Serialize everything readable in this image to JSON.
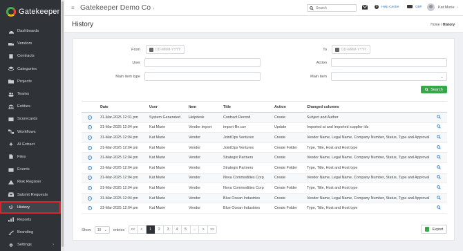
{
  "app": {
    "name": "Gatekeeper",
    "company": "Gatekeeper Demo Co",
    "company_caret": "›"
  },
  "topbar": {
    "search_placeholder": "Search",
    "help": "Help Centre",
    "currency": "GBP",
    "user": "Kat Murie",
    "user_caret": "›"
  },
  "sidebar": {
    "items": [
      {
        "label": "Dashboards",
        "icon": "dashboard-icon"
      },
      {
        "label": "Vendors",
        "icon": "truck-icon"
      },
      {
        "label": "Contracts",
        "icon": "contract-icon"
      },
      {
        "label": "Categories",
        "icon": "layers-icon"
      },
      {
        "label": "Projects",
        "icon": "folder-icon"
      },
      {
        "label": "Teams",
        "icon": "users-icon"
      },
      {
        "label": "Entities",
        "icon": "building-icon"
      },
      {
        "label": "Scorecards",
        "icon": "scorecard-icon"
      },
      {
        "label": "Workflows",
        "icon": "workflow-icon"
      },
      {
        "label": "AI Extract",
        "icon": "sparkle-icon"
      },
      {
        "label": "Files",
        "icon": "file-icon"
      },
      {
        "label": "Events",
        "icon": "calendar-icon"
      },
      {
        "label": "Risk Register",
        "icon": "warning-icon"
      },
      {
        "label": "Submit Requests",
        "icon": "inbox-icon"
      },
      {
        "label": "History",
        "icon": "history-icon",
        "active": true
      },
      {
        "label": "Reports",
        "icon": "chart-icon"
      },
      {
        "label": "Branding",
        "icon": "brush-icon"
      },
      {
        "label": "Settings",
        "icon": "gear-icon",
        "caret": "›"
      }
    ]
  },
  "page": {
    "title": "History",
    "breadcrumb": {
      "home": "Home",
      "sep": "/",
      "current": "History"
    }
  },
  "filters": {
    "from_label": "From",
    "from_placeholder": "DD-MMM-YYYY",
    "to_label": "To",
    "to_placeholder": "DD-MMM-YYYY",
    "user_label": "User",
    "action_label": "Action",
    "main_item_type_label": "Main item type",
    "main_item_label": "Main item",
    "search_button": "Search"
  },
  "table": {
    "columns": [
      "Date",
      "User",
      "Item",
      "Title",
      "Action",
      "Changed columns"
    ],
    "rows": [
      [
        "31-Mar-2025 12:31 pm",
        "System Generated",
        "Helpdesk",
        "Contract Record",
        "Create",
        "Subject and Author"
      ],
      [
        "31-Mar-2025 12:04 pm",
        "Kat Murie",
        "Vendor import",
        "import file.csv",
        "Update",
        "Imported at and Imported supplier ids"
      ],
      [
        "31-Mar-2025 12:04 pm",
        "Kat Murie",
        "Vendor",
        "JointOps Ventures",
        "Create",
        "Vendor Name, Legal Name, Company Number, Status, Type and Approval"
      ],
      [
        "31-Mar-2025 12:04 pm",
        "Kat Murie",
        "Vendor",
        "JointOps Ventures",
        "Create Folder",
        "Type, Title, Host and Host type"
      ],
      [
        "31-Mar-2025 12:04 pm",
        "Kat Murie",
        "Vendor",
        "Strategix Partners",
        "Create",
        "Vendor Name, Legal Name, Company Number, Status, Type and Approval"
      ],
      [
        "31-Mar-2025 12:04 pm",
        "Kat Murie",
        "Vendor",
        "Strategix Partners",
        "Create Folder",
        "Type, Title, Host and Host type"
      ],
      [
        "31-Mar-2025 12:04 pm",
        "Kat Murie",
        "Vendor",
        "Nova Commodities Corp",
        "Create",
        "Vendor Name, Legal Name, Company Number, Status, Type and Approval"
      ],
      [
        "31-Mar-2025 12:04 pm",
        "Kat Murie",
        "Vendor",
        "Nova Commodities Corp",
        "Create Folder",
        "Type, Title, Host and Host type"
      ],
      [
        "31-Mar-2025 12:04 pm",
        "Kat Murie",
        "Vendor",
        "Blue Ocean Industries",
        "Create",
        "Vendor Name, Legal Name, Company Number, Status, Type and Approval"
      ],
      [
        "31-Mar-2025 12:04 pm",
        "Kat Murie",
        "Vendor",
        "Blue Ocean Industries",
        "Create Folder",
        "Type, Title, Host and Host type"
      ]
    ]
  },
  "footer": {
    "show_label": "Show",
    "entries_value": "10",
    "entries_label": "entries",
    "pages": [
      "<<",
      "<",
      "1",
      "2",
      "3",
      "4",
      "5",
      "...",
      ">",
      ">>"
    ],
    "active_page": "1",
    "export": "Export"
  },
  "colors": {
    "sidebar_bg": "#2f3237",
    "active_outline": "#e0232a",
    "accent_green": "#3aa64a",
    "link_blue": "#2f6fb3"
  }
}
